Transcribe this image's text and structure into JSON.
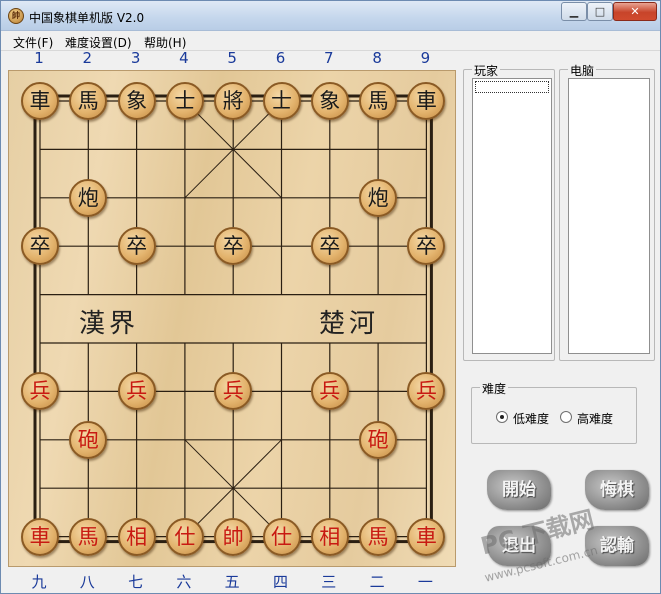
{
  "window": {
    "title": "中国象棋单机版 V2.0",
    "icon": "app-chess-icon",
    "controls": {
      "minimize": "▁",
      "maximize": "□",
      "close": "✕"
    }
  },
  "menu": [
    {
      "label": "文件(F)"
    },
    {
      "label": "难度设置(D)"
    },
    {
      "label": "帮助(H)"
    }
  ],
  "board": {
    "top_labels": [
      "1",
      "2",
      "3",
      "4",
      "5",
      "6",
      "7",
      "8",
      "9"
    ],
    "bottom_labels": [
      "九",
      "八",
      "七",
      "六",
      "五",
      "四",
      "三",
      "二",
      "一"
    ],
    "river_left": "漢界",
    "river_right": "楚河",
    "pieces": [
      {
        "char": "車",
        "side": "black",
        "file": 0,
        "rank": 0
      },
      {
        "char": "馬",
        "side": "black",
        "file": 1,
        "rank": 0
      },
      {
        "char": "象",
        "side": "black",
        "file": 2,
        "rank": 0
      },
      {
        "char": "士",
        "side": "black",
        "file": 3,
        "rank": 0
      },
      {
        "char": "將",
        "side": "black",
        "file": 4,
        "rank": 0
      },
      {
        "char": "士",
        "side": "black",
        "file": 5,
        "rank": 0
      },
      {
        "char": "象",
        "side": "black",
        "file": 6,
        "rank": 0
      },
      {
        "char": "馬",
        "side": "black",
        "file": 7,
        "rank": 0
      },
      {
        "char": "車",
        "side": "black",
        "file": 8,
        "rank": 0
      },
      {
        "char": "炮",
        "side": "black",
        "file": 1,
        "rank": 2
      },
      {
        "char": "炮",
        "side": "black",
        "file": 7,
        "rank": 2
      },
      {
        "char": "卒",
        "side": "black",
        "file": 0,
        "rank": 3
      },
      {
        "char": "卒",
        "side": "black",
        "file": 2,
        "rank": 3
      },
      {
        "char": "卒",
        "side": "black",
        "file": 4,
        "rank": 3
      },
      {
        "char": "卒",
        "side": "black",
        "file": 6,
        "rank": 3
      },
      {
        "char": "卒",
        "side": "black",
        "file": 8,
        "rank": 3
      },
      {
        "char": "兵",
        "side": "red",
        "file": 0,
        "rank": 6
      },
      {
        "char": "兵",
        "side": "red",
        "file": 2,
        "rank": 6
      },
      {
        "char": "兵",
        "side": "red",
        "file": 4,
        "rank": 6
      },
      {
        "char": "兵",
        "side": "red",
        "file": 6,
        "rank": 6
      },
      {
        "char": "兵",
        "side": "red",
        "file": 8,
        "rank": 6
      },
      {
        "char": "砲",
        "side": "red",
        "file": 1,
        "rank": 7
      },
      {
        "char": "砲",
        "side": "red",
        "file": 7,
        "rank": 7
      },
      {
        "char": "車",
        "side": "red",
        "file": 0,
        "rank": 9
      },
      {
        "char": "馬",
        "side": "red",
        "file": 1,
        "rank": 9
      },
      {
        "char": "相",
        "side": "red",
        "file": 2,
        "rank": 9
      },
      {
        "char": "仕",
        "side": "red",
        "file": 3,
        "rank": 9
      },
      {
        "char": "帥",
        "side": "red",
        "file": 4,
        "rank": 9
      },
      {
        "char": "仕",
        "side": "red",
        "file": 5,
        "rank": 9
      },
      {
        "char": "相",
        "side": "red",
        "file": 6,
        "rank": 9
      },
      {
        "char": "馬",
        "side": "red",
        "file": 7,
        "rank": 9
      },
      {
        "char": "車",
        "side": "red",
        "file": 8,
        "rank": 9
      }
    ]
  },
  "panels": {
    "player_label": "玩家",
    "computer_label": "电脑"
  },
  "difficulty": {
    "label": "难度",
    "options": [
      {
        "label": "低难度",
        "selected": true
      },
      {
        "label": "高难度",
        "selected": false
      }
    ]
  },
  "buttons": {
    "start": "開始",
    "undo": "悔棋",
    "surrender": "認輸",
    "exit": "退出"
  },
  "watermark": {
    "line1": "PC 下载网",
    "line2": "www.pcsoft.com.cn"
  },
  "colors": {
    "red_piece": "#c81a12",
    "black_piece": "#1a1a1a",
    "label_blue": "#1a3a9a"
  }
}
